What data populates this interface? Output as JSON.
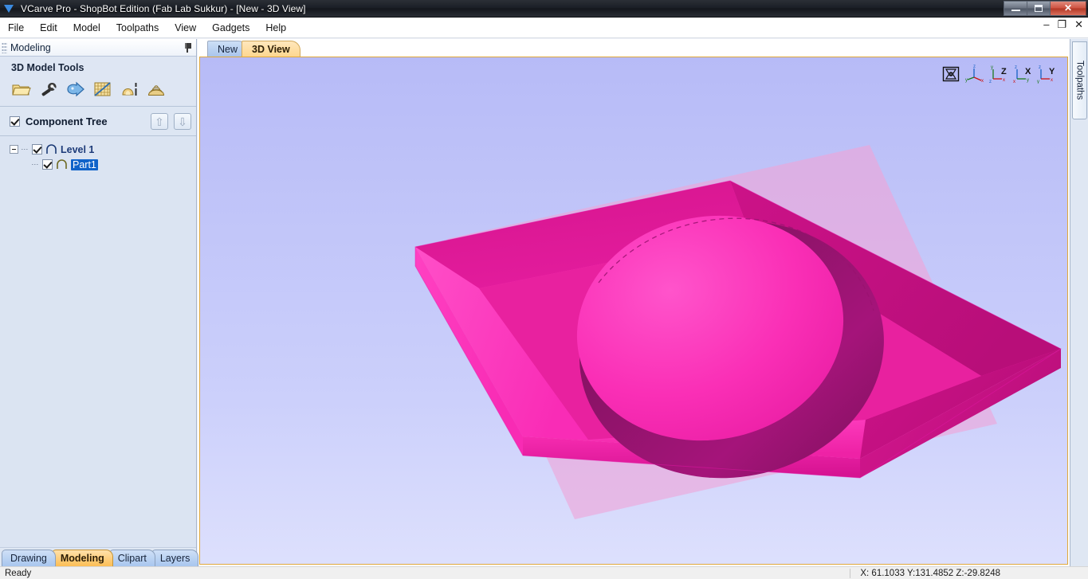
{
  "window": {
    "title": "VCarve Pro - ShopBot Edition (Fab Lab Sukkur) - [New - 3D View]",
    "logo_icon": "vcarve-triangle-logo",
    "minimize_label": "—",
    "maximize_label": "□",
    "close_label": "✕"
  },
  "menu": {
    "items": [
      {
        "label": "File"
      },
      {
        "label": "Edit"
      },
      {
        "label": "Model"
      },
      {
        "label": "Toolpaths"
      },
      {
        "label": "View"
      },
      {
        "label": "Gadgets"
      },
      {
        "label": "Help"
      }
    ]
  },
  "mdi_controls": {
    "minimize": "–",
    "restore": "❐",
    "close": "✕"
  },
  "left_panel": {
    "header_title": "Modeling",
    "pin_icon": "pushpin-icon",
    "tools": {
      "title": "3D Model Tools",
      "buttons": [
        {
          "label": "Import Component / 3D Model",
          "icon": "open-folder-icon"
        },
        {
          "label": "Component Properties",
          "icon": "wrench-icon"
        },
        {
          "label": "Create Shape from Vector",
          "icon": "blue-arrow-shape-icon"
        },
        {
          "label": "Modelling Grid / Fade",
          "icon": "grid-ruler-icon"
        },
        {
          "label": "Mirror Component",
          "icon": "mirror-dome-icon"
        },
        {
          "label": "Bake / Merge Component",
          "icon": "layered-dome-icon"
        }
      ]
    },
    "component_tree": {
      "title": "Component Tree",
      "checked": true,
      "move_up_glyph": "⇧",
      "move_down_glyph": "⇩",
      "nodes": [
        {
          "label": "Level 1",
          "checked": true,
          "selected": false,
          "icon": "arch-shape-icon-blue",
          "expanded": true
        },
        {
          "label": "Part1",
          "checked": true,
          "selected": true,
          "icon": "arch-shape-icon-olive"
        }
      ]
    },
    "mode_tabs": [
      {
        "label": "Drawing",
        "active": false
      },
      {
        "label": "Modeling",
        "active": true
      },
      {
        "label": "Clipart",
        "active": false
      },
      {
        "label": "Layers",
        "active": false
      }
    ]
  },
  "view_area": {
    "tabs": [
      {
        "label": "New",
        "active": false
      },
      {
        "label": "3D View",
        "active": true
      }
    ],
    "toolbar": [
      {
        "label": "Zoom to Fit / Isometric Box",
        "icon": "fit-view-box-icon"
      },
      {
        "label": "Isometric View",
        "icon": "axis-gizmo-iso-icon"
      },
      {
        "label": "Z Plan View",
        "icon": "axis-z-view-icon"
      },
      {
        "label": "X Front View",
        "icon": "axis-x-view-icon"
      },
      {
        "label": "Y Side View",
        "icon": "axis-y-view-icon"
      }
    ],
    "model": {
      "description": "Square beveled plate with circular domed pocket",
      "colors": {
        "background_top": "#B7BBF7",
        "background_bottom": "#DDE0FD",
        "material_plane": "#EFA5D9",
        "surface_light": "#FF3BBE",
        "surface_top": "#FA2BB0",
        "bevel_mid": "#E01C9B",
        "bevel_dark": "#C2137F",
        "pocket_shadow": "#8C1269",
        "pocket_deep": "#6E0D52"
      }
    }
  },
  "right_panel": {
    "tab_label": "Toolpaths"
  },
  "status_bar": {
    "message": "Ready",
    "coordinates": "X: 61.1033 Y:131.4852 Z:-29.8248"
  }
}
